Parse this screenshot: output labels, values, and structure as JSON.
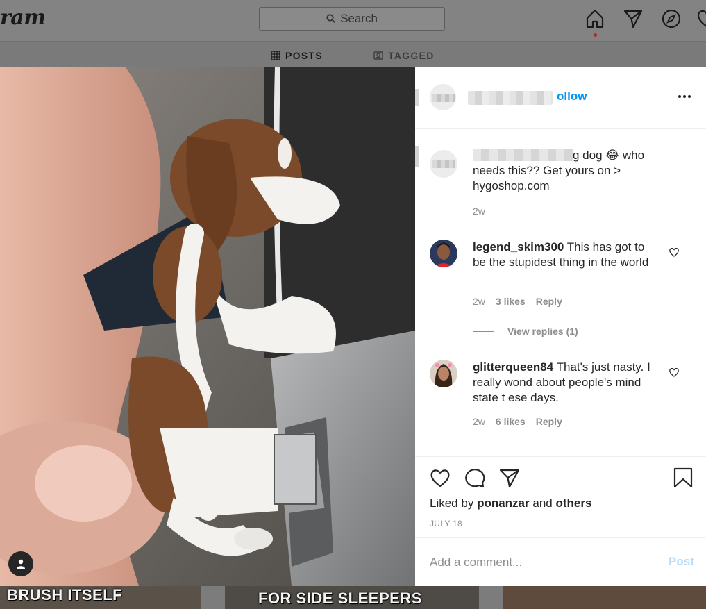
{
  "app": {
    "logo_text": "ram"
  },
  "search": {
    "placeholder": "Search"
  },
  "nav": {
    "icons": [
      "home-icon",
      "direct-icon",
      "explore-icon",
      "activity-icon"
    ]
  },
  "profile_tabs": [
    {
      "label": "POSTS",
      "icon": "grid-icon"
    },
    {
      "label": "TAGGED",
      "icon": "tag-icon"
    }
  ],
  "grid_thumbs": [
    {
      "text": "BRUSH ITSELF"
    },
    {
      "text_top": "",
      "text": "FOR SIDE SLEEPERS"
    },
    {
      "text": ""
    }
  ],
  "post": {
    "header": {
      "follow_label": "ollow",
      "more_icon": "more-icon"
    },
    "caption": {
      "text_line1": "g dog 😂 who",
      "text_rest": "needs this?? Get yours on > hygoshop.com",
      "time": "2w"
    },
    "comments": [
      {
        "username": "legend_skim300",
        "text": "This has got to be the stupidest thing in the world",
        "time": "2w",
        "likes": "3 likes",
        "reply_label": "Reply",
        "view_replies": "View replies (1)"
      },
      {
        "username": "glitterqueen84",
        "text": "That's just nasty. I really wond  about people's mind state t ese days.",
        "time": "2w",
        "likes": "6 likes",
        "reply_label": "Reply"
      }
    ],
    "actions": {
      "liked_prefix": "Liked by",
      "liked_user": "ponanzar",
      "liked_and": "and",
      "liked_others": "others",
      "date": "JULY 18"
    },
    "add_comment": {
      "placeholder": "Add a comment...",
      "post_label": "Post"
    }
  },
  "colors": {
    "accent": "#0095f6",
    "post_disabled": "#b2dffc",
    "muted": "#8e8e8e",
    "text": "#262626"
  }
}
